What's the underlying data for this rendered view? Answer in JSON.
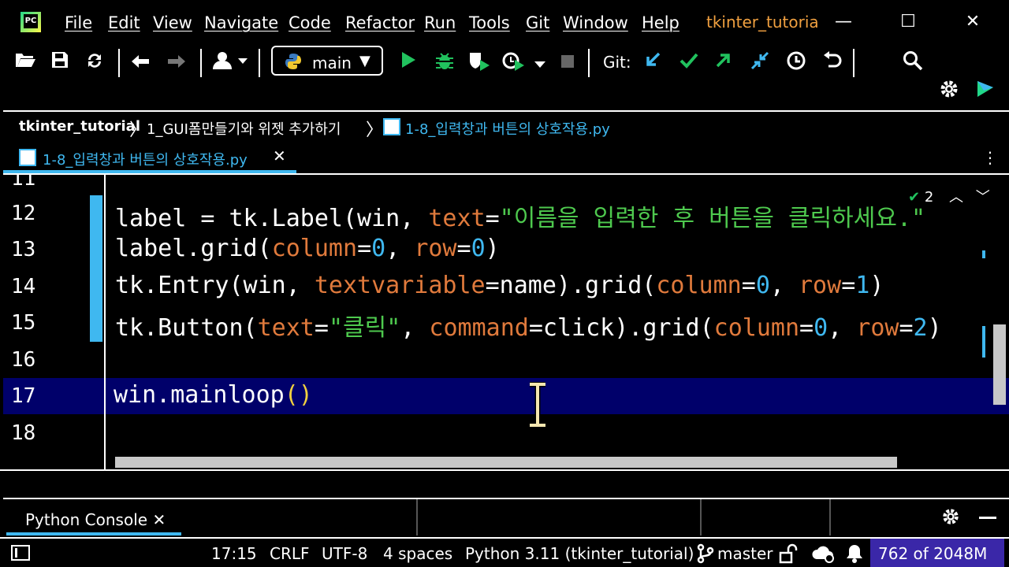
{
  "app": {
    "logo_text": "PC",
    "project_title": "tkinter_tutoria"
  },
  "menu": [
    "File",
    "Edit",
    "View",
    "Navigate",
    "Code",
    "Refactor",
    "Run",
    "Tools",
    "Git",
    "Window",
    "Help"
  ],
  "window_controls": {
    "minimize": "—",
    "maximize": "☐",
    "close": "✕"
  },
  "toolbar": {
    "branch": "main",
    "git_label": "Git:"
  },
  "breadcrumb": [
    "tkinter_tutorial",
    "1_GUI폼만들기와 위젯 추가하기",
    "1-8_입력창과 버튼의 상호작용.py"
  ],
  "tabs": [
    {
      "label": "1-8_입력창과 버튼의 상호작용.py",
      "close": "✕"
    }
  ],
  "editor": {
    "partial_line_no": "11",
    "inspection_count": "2",
    "lines": [
      {
        "no": "12"
      },
      {
        "no": "13"
      },
      {
        "no": "14"
      },
      {
        "no": "15"
      },
      {
        "no": "16"
      },
      {
        "no": "17"
      },
      {
        "no": "18"
      }
    ],
    "code": {
      "l12": {
        "a": "label = tk.Label(win, ",
        "param": "text",
        "eq": "=",
        "str": "\"이름을 입력한 후 버튼을 클릭하세요.\""
      },
      "l13": {
        "a": "label.grid(",
        "p1": "column",
        "e1": "=",
        "n1": "0",
        "c1": ", ",
        "p2": "row",
        "e2": "=",
        "n2": "0",
        "z": ")"
      },
      "l14": {
        "a": "tk.Entry(win, ",
        "p1": "textvariable",
        "b": "=name).grid(",
        "p2": "column",
        "e2": "=",
        "n2": "0",
        "c2": ", ",
        "p3": "row",
        "e3": "=",
        "n3": "1",
        "z": ")"
      },
      "l15": {
        "a": "tk.Button(",
        "p1": "text",
        "e1": "=",
        "s1": "\"클릭\"",
        "c1": ", ",
        "p2": "command",
        "b": "=click).grid(",
        "p3": "column",
        "e3": "=",
        "n3": "0",
        "c3": ", ",
        "p4": "row",
        "e4": "=",
        "n4": "2",
        "z": ")"
      },
      "l17": {
        "a": "win.mainloop",
        "paren": "()"
      }
    }
  },
  "console": {
    "tab_label": "Python Console",
    "close": "✕"
  },
  "statusbar": {
    "position": "17:15",
    "line_sep": "CRLF",
    "encoding": "UTF-8",
    "indent": "4 spaces",
    "interpreter": "Python 3.11 (tkinter_tutorial)",
    "vcs_branch": "master",
    "memory": "762 of 2048M"
  },
  "colors": {
    "accent": "#3fb8f0",
    "param": "#e07a3c",
    "string": "#4ec94e",
    "current_line": "#00006a",
    "memory_bg": "#3a27a8",
    "project_title": "#f0a040"
  }
}
